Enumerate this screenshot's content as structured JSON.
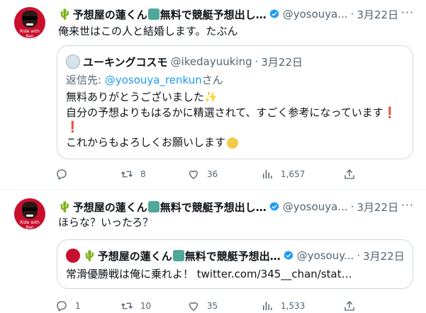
{
  "tweets": [
    {
      "name": "予想屋の蓮くん",
      "name_suffix": "無料で競艇予想出し…",
      "handle": "@yosouya...",
      "dot": "·",
      "date": "3月22日",
      "text": "俺来世はこの人と結婚します。たぶん",
      "quote": {
        "name": "ユーキングコスモ",
        "handle": "@ikedayuuking",
        "dot": "·",
        "date": "3月22日",
        "reply_prefix": "返信先: ",
        "reply_user": "@yosouya_renkun",
        "reply_suffix": "さん",
        "line1": "無料ありがとうございました",
        "line2": "自分の予想よりもはるかに精選されて、すごく参考になっています",
        "line4": "これからもよろしくお願いします"
      },
      "actions": {
        "reply": "",
        "retweet": "8",
        "like": "36",
        "views": "1,657"
      }
    },
    {
      "name": "予想屋の蓮くん",
      "name_suffix": "無料で競艇予想出し…",
      "handle": "@yosouya...",
      "dot": "·",
      "date": "3月22日",
      "text": "ほらな？いったろ？",
      "quote": {
        "name": "予想屋の蓮くん",
        "name_suffix": "無料で競艇予想出…",
        "handle": "@yosouy...",
        "dot": "·",
        "date": "3月22日",
        "line1": "常滑優勝戦は俺に乗れよ！ twitter.com/345__chan/stat…"
      },
      "actions": {
        "reply": "1",
        "retweet": "10",
        "like": "35",
        "views": "1,533"
      }
    }
  ],
  "avatar_caption": "Ride with Ren",
  "colors": {
    "accent": "#1d9bf0",
    "muted": "#536471",
    "border": "#cfd9de",
    "text": "#0f1419"
  },
  "icons": [
    "verified-icon",
    "more-icon",
    "reply-icon",
    "retweet-icon",
    "like-icon",
    "views-icon",
    "share-icon",
    "cactus-icon",
    "statue-icon",
    "sparkle-icon",
    "exclamation-icon",
    "emoji-person-icon"
  ]
}
